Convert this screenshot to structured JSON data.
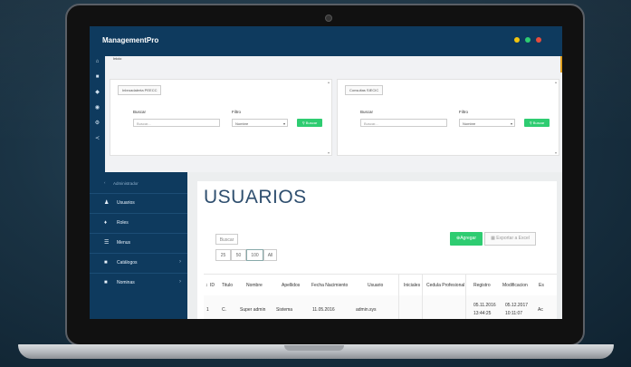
{
  "app": {
    "brand": "ManagementPro",
    "dots": [
      "#f1c40f",
      "#2ecc71",
      "#e74c3c"
    ]
  },
  "upper": {
    "breadcrumb": "Inicio",
    "panels": [
      {
        "tag": "Inbroadalerta PEECC",
        "buscar_label": "Buscar",
        "placeholder": "Buscar...",
        "filtro_label": "Filtro",
        "filtro_value": "Nombre",
        "button": "Buscar"
      },
      {
        "tag": "Consultas SIECIC",
        "buscar_label": "Buscar",
        "placeholder": "Buscar...",
        "filtro_label": "Filtro",
        "filtro_value": "Nombre",
        "button": "Buscar"
      }
    ]
  },
  "sidebar": {
    "header": "Administrador",
    "items": [
      {
        "label": "Usuarios",
        "icon": "users-icon",
        "glyph": "♟"
      },
      {
        "label": "Roles",
        "icon": "role-icon",
        "glyph": "♦"
      },
      {
        "label": "Menus",
        "icon": "menu-icon",
        "glyph": "☰"
      },
      {
        "label": "Catálogos",
        "icon": "folder-icon",
        "glyph": "■",
        "chevron": "›"
      },
      {
        "label": "Nominas",
        "icon": "book-icon",
        "glyph": "■",
        "chevron": "›"
      }
    ]
  },
  "main": {
    "title": "USUARIOS",
    "search_button": "Buscar",
    "page_sizes": [
      "25",
      "50",
      "100",
      "All"
    ],
    "add_button": "Agregar",
    "export_button": "Exportar a Excel",
    "columns": [
      "ID",
      "Titulo",
      "Nombre",
      "Apellidos",
      "Fecha Nacimiento",
      "Usuario",
      "Iniciales",
      "Cedula Profesional",
      "Registro",
      "Modificacion",
      "Es"
    ],
    "rows": [
      {
        "id": "1",
        "titulo": "C.",
        "nombre": "Super admin",
        "apellidos": "Sistema",
        "fecha": "11.05.2016",
        "usuario": "admin.sys",
        "iniciales": "",
        "cedula": "",
        "registro_date": "05.11.2016",
        "registro_time": "13:44:25",
        "mod_date": "05.12.2017",
        "mod_time": "10:11:07",
        "estado": "Ac"
      }
    ]
  }
}
